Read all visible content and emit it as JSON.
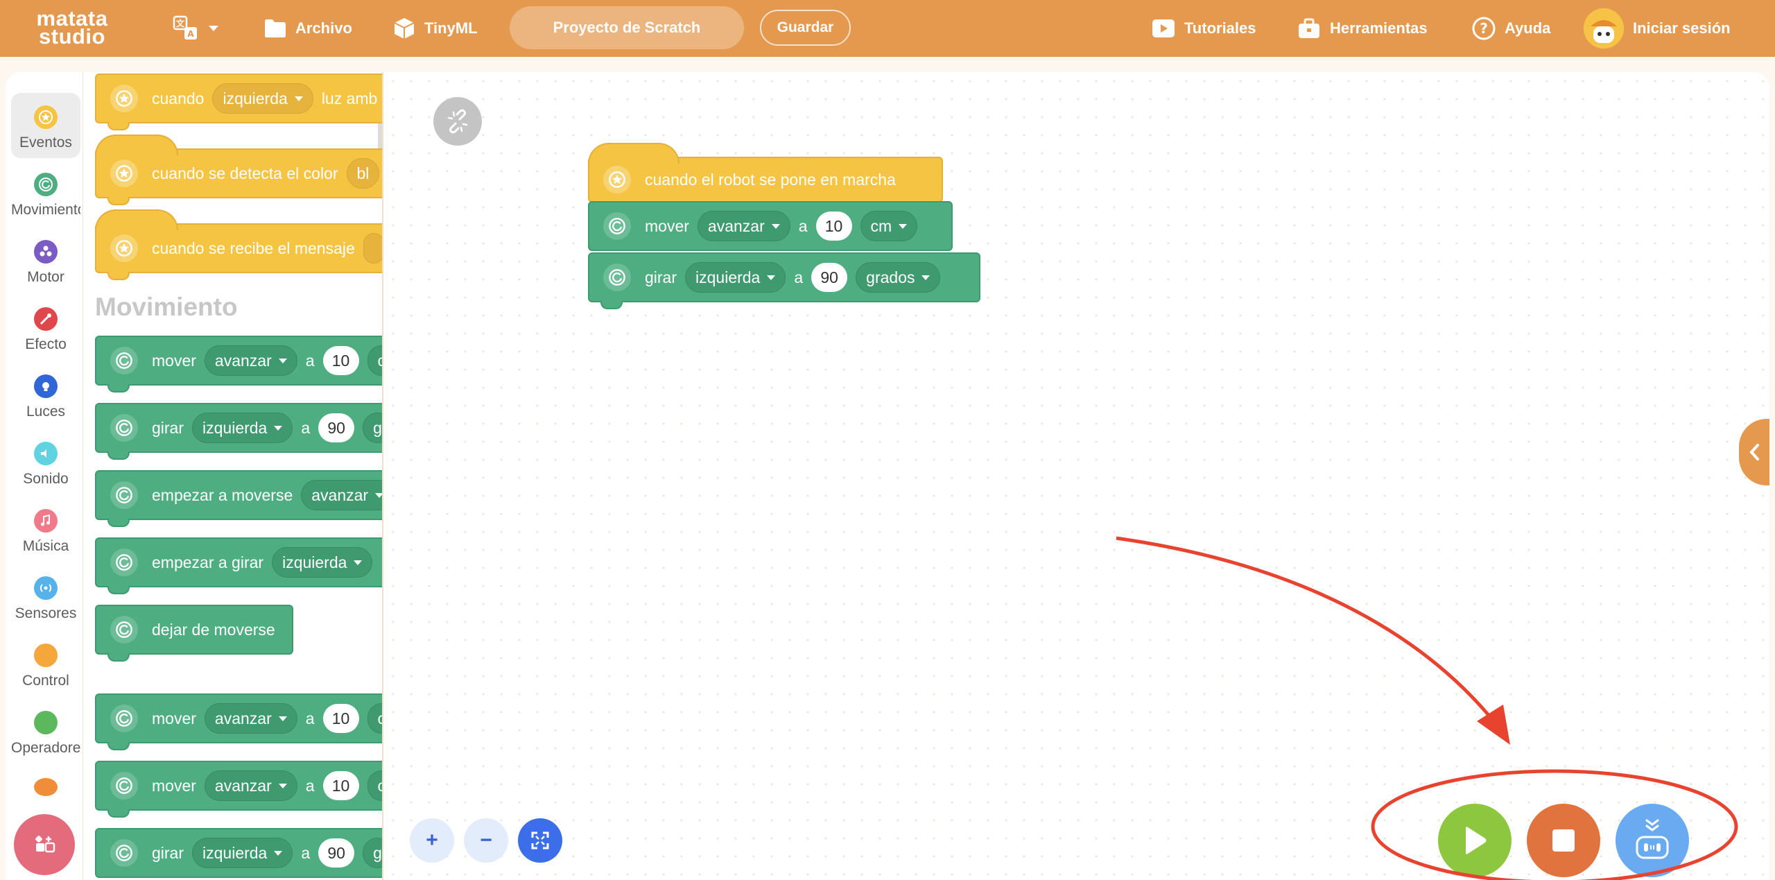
{
  "app": {
    "logo_line1": "matata",
    "logo_line2": "studio"
  },
  "topbar": {
    "language_icon": "translate-icon",
    "archivo": "Archivo",
    "tinyml": "TinyML",
    "project_name": "Proyecto de Scratch",
    "save": "Guardar",
    "tutorials": "Tutoriales",
    "tools": "Herramientas",
    "help": "Ayuda",
    "login": "Iniciar sesión"
  },
  "categories": [
    {
      "label": "Eventos",
      "color": "#f5c443",
      "active": true
    },
    {
      "label": "Movimiento",
      "color": "#4eae82"
    },
    {
      "label": "Motor",
      "color": "#7b5cc4"
    },
    {
      "label": "Efecto",
      "color": "#e0474c"
    },
    {
      "label": "Luces",
      "color": "#3166d6"
    },
    {
      "label": "Sonido",
      "color": "#5fd3e0"
    },
    {
      "label": "Música",
      "color": "#f07a8a"
    },
    {
      "label": "Sensores",
      "color": "#55b2ea"
    },
    {
      "label": "Control",
      "color": "#f5a73b"
    },
    {
      "label": "Operadores",
      "color": "#5cb85c"
    },
    {
      "label": "",
      "color": "#f08d3a"
    }
  ],
  "palette": {
    "section_title": "Movimiento",
    "events": [
      {
        "text1": "cuando",
        "dropdown": "izquierda",
        "text2": "luz amb"
      },
      {
        "text1": "cuando se detecta el color",
        "dropdown": "bl"
      },
      {
        "text1": "cuando se recibe el mensaje"
      }
    ],
    "motion": [
      {
        "text1": "mover",
        "dropdown": "avanzar",
        "text2": "a",
        "value": "10",
        "text3": "c"
      },
      {
        "text1": "girar",
        "dropdown": "izquierda",
        "text2": "a",
        "value": "90",
        "text3": "g"
      },
      {
        "text1": "empezar a moverse",
        "dropdown": "avanzar"
      },
      {
        "text1": "empezar a girar",
        "dropdown": "izquierda"
      },
      {
        "text1": "dejar de moverse"
      },
      {
        "text1": "mover",
        "dropdown": "avanzar",
        "text2": "a",
        "value": "10",
        "text3": "c"
      },
      {
        "text1": "mover",
        "dropdown": "avanzar",
        "text2": "a",
        "value": "10",
        "text3": "c"
      },
      {
        "text1": "girar",
        "dropdown": "izquierda",
        "text2": "a",
        "value": "90",
        "text3": "g"
      }
    ]
  },
  "script": {
    "hat": "cuando el robot se pone en marcha",
    "move": {
      "text1": "mover",
      "dropdown": "avanzar",
      "text2": "a",
      "value": "10",
      "unit": "cm"
    },
    "turn": {
      "text1": "girar",
      "dropdown": "izquierda",
      "text2": "a",
      "value": "90",
      "unit": "grados"
    }
  },
  "zoom": {
    "in": "+",
    "out": "−"
  },
  "run_controls": {
    "play_color": "#8dc63f",
    "stop_color": "#e0733e",
    "upload_color": "#6aaaf0",
    "annotation_color": "#e8432f"
  }
}
